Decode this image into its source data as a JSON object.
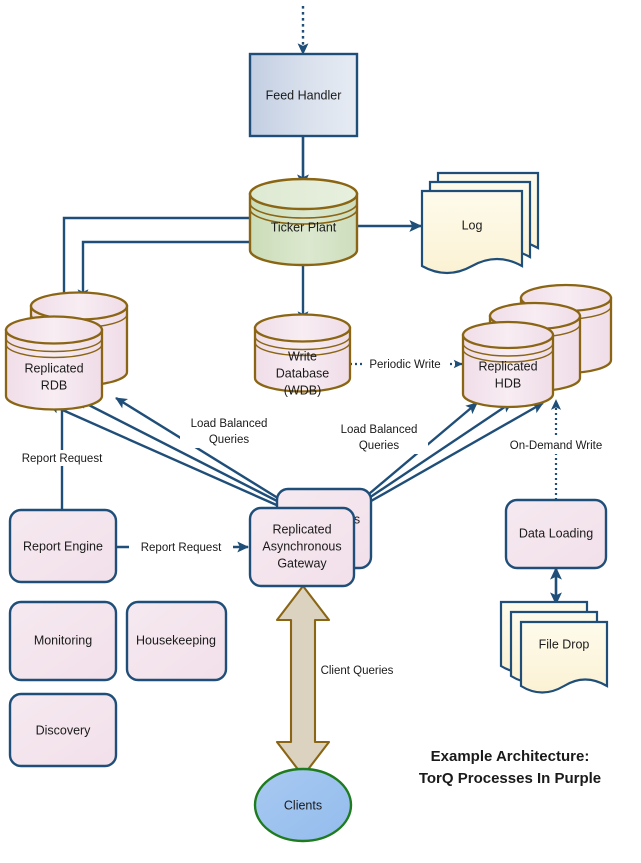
{
  "diagram": {
    "title_line1": "Example Architecture:",
    "title_line2": "TorQ Processes In Purple",
    "nodes": {
      "feed_handler": "Feed Handler",
      "ticker_plant": "Ticker Plant",
      "log": "Log",
      "replicated_rdb_line1": "Replicated",
      "replicated_rdb_line2": "RDB",
      "wdb_line1": "Write",
      "wdb_line2": "Database",
      "wdb_line3": "(WDB)",
      "replicated_hdb_line1": "Replicated",
      "replicated_hdb_line2": "HDB",
      "gateway_line1": "Replicated",
      "gateway_line2": "Asynchronous",
      "gateway_line3": "Gateway",
      "gateway_back_partial": "s",
      "report_engine": "Report Engine",
      "monitoring": "Monitoring",
      "housekeeping": "Housekeeping",
      "discovery": "Discovery",
      "data_loading": "Data Loading",
      "file_drop": "File Drop",
      "clients": "Clients"
    },
    "edges": {
      "periodic_write": "Periodic Write",
      "on_demand_write": "On-Demand Write",
      "load_balanced_queries_left_l1": "Load Balanced",
      "load_balanced_queries_left_l2": "Queries",
      "load_balanced_queries_right_l1": "Load Balanced",
      "load_balanced_queries_right_l2": "Queries",
      "report_request_vertical": "Report Request",
      "report_request_horizontal": "Report Request",
      "client_queries": "Client Queries"
    },
    "colors": {
      "blue_stroke": "#1F4E79",
      "blue_fill": "#D4DCEA",
      "green_fill": "#D5E3C6",
      "olive_stroke": "#8A6513",
      "pink_fill": "#F4E3EB",
      "cream_fill": "#FDF6DC",
      "tan_fill": "#DCD2C0",
      "tan_stroke": "#8A6513",
      "clients_fill": "#9DC3F0",
      "clients_stroke": "#1E7B1E",
      "text": "#1A1A1A"
    }
  }
}
